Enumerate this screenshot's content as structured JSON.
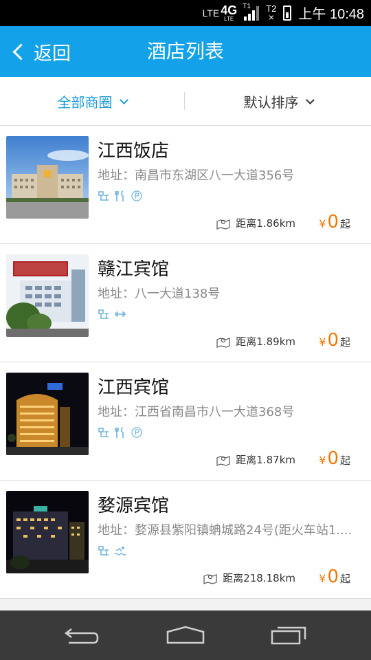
{
  "status_bar": {
    "network_lte": "LTE",
    "network_4g": "4G",
    "network_sub": "LTE",
    "sim1": "T1",
    "sim2": "T2",
    "time": "上午 10:48"
  },
  "header": {
    "back_label": "返回",
    "title": "酒店列表"
  },
  "filters": {
    "area": "全部商圈",
    "sort": "默认排序"
  },
  "hotels": [
    {
      "name": "江西饭店",
      "address": "地址：南昌市东湖区八一大道356号",
      "distance": "距离1.86km",
      "currency": "¥",
      "price": "0",
      "price_suffix": "起",
      "amenities": [
        "wifi-icon",
        "restaurant-icon",
        "parking-icon"
      ]
    },
    {
      "name": "赣江宾馆",
      "address": "地址：八一大道138号",
      "distance": "距离1.89km",
      "currency": "¥",
      "price": "0",
      "price_suffix": "起",
      "amenities": [
        "wifi-icon",
        "gym-icon"
      ]
    },
    {
      "name": "江西宾馆",
      "address": "地址：江西省南昌市八一大道368号",
      "distance": "距离1.87km",
      "currency": "¥",
      "price": "0",
      "price_suffix": "起",
      "amenities": [
        "wifi-icon",
        "restaurant-icon",
        "parking-icon"
      ]
    },
    {
      "name": "婺源宾馆",
      "address": "地址：婺源县紫阳镇蚺城路24号(距火车站1....",
      "distance": "距离218.18km",
      "currency": "¥",
      "price": "0",
      "price_suffix": "起",
      "amenities": [
        "wifi-icon",
        "swimming-icon"
      ]
    }
  ],
  "colors": {
    "header_bg": "#13a2ea",
    "filter_active": "#1a9ad7",
    "price": "#f07800",
    "amenity_icon": "#6fb3dc",
    "nav_bar": "#3a3a3a"
  }
}
